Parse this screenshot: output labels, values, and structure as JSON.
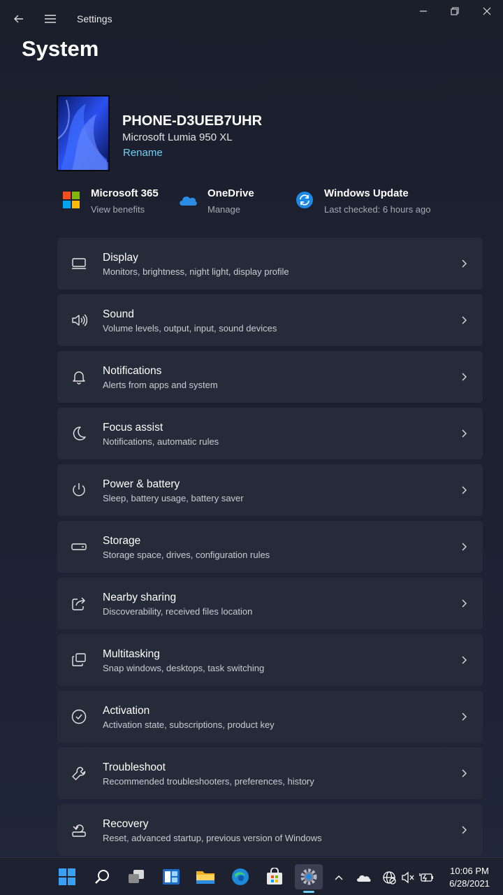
{
  "window": {
    "app_title": "Settings",
    "page_title": "System"
  },
  "device": {
    "name": "PHONE-D3UEB7UHR",
    "model": "Microsoft Lumia 950 XL",
    "rename_label": "Rename"
  },
  "quick_links": [
    {
      "title": "Microsoft 365",
      "subtitle": "View benefits",
      "icon": "microsoft-365-icon"
    },
    {
      "title": "OneDrive",
      "subtitle": "Manage",
      "icon": "onedrive-icon"
    },
    {
      "title": "Windows Update",
      "subtitle": "Last checked: 6 hours ago",
      "icon": "windows-update-icon"
    }
  ],
  "settings": [
    {
      "title": "Display",
      "subtitle": "Monitors, brightness, night light, display profile",
      "icon": "display-icon"
    },
    {
      "title": "Sound",
      "subtitle": "Volume levels, output, input, sound devices",
      "icon": "sound-icon"
    },
    {
      "title": "Notifications",
      "subtitle": "Alerts from apps and system",
      "icon": "bell-icon"
    },
    {
      "title": "Focus assist",
      "subtitle": "Notifications, automatic rules",
      "icon": "moon-icon"
    },
    {
      "title": "Power & battery",
      "subtitle": "Sleep, battery usage, battery saver",
      "icon": "power-icon"
    },
    {
      "title": "Storage",
      "subtitle": "Storage space, drives, configuration rules",
      "icon": "storage-icon"
    },
    {
      "title": "Nearby sharing",
      "subtitle": "Discoverability, received files location",
      "icon": "share-icon"
    },
    {
      "title": "Multitasking",
      "subtitle": "Snap windows, desktops, task switching",
      "icon": "multitasking-icon"
    },
    {
      "title": "Activation",
      "subtitle": "Activation state, subscriptions, product key",
      "icon": "check-circle-icon"
    },
    {
      "title": "Troubleshoot",
      "subtitle": "Recommended troubleshooters, preferences, history",
      "icon": "wrench-icon"
    },
    {
      "title": "Recovery",
      "subtitle": "Reset, advanced startup, previous version of Windows",
      "icon": "recovery-icon"
    }
  ],
  "taskbar": {
    "apps": [
      "start-icon",
      "search-icon",
      "task-view-icon",
      "widgets-icon",
      "file-explorer-icon",
      "edge-icon",
      "store-icon",
      "settings-icon"
    ],
    "tray": [
      "chevron-up-icon",
      "onedrive-tray-icon",
      "network-icon",
      "volume-muted-icon",
      "battery-icon"
    ],
    "time": "10:06 PM",
    "date": "6/28/2021"
  },
  "colors": {
    "accent": "#6ccff6",
    "card": "#262b3a",
    "background": "#1c2030"
  }
}
